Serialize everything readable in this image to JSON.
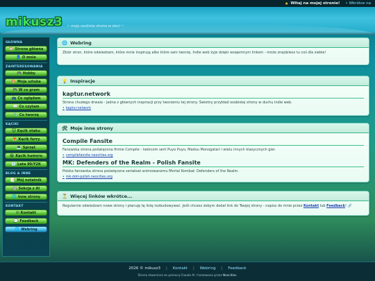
{
  "topbar": {
    "welcome": "Witaj na mojej stronie!",
    "soon": "Wkrótce na"
  },
  "header": {
    "logo": "mikusz3",
    "tagline": "~ moja osobista strona w sieci ~"
  },
  "sidebar": {
    "sections": [
      {
        "title": "GŁÓWNA",
        "items": [
          {
            "icon": "🏠",
            "label": "Strona główna"
          },
          {
            "icon": "👤",
            "label": "O mnie"
          }
        ]
      },
      {
        "title": "ZAINTERESOWANIA",
        "items": [
          {
            "icon": "🎮",
            "label": "Hobby"
          },
          {
            "icon": "🎨",
            "label": "Moja sztuka"
          },
          {
            "icon": "🎮",
            "label": "W co gram"
          },
          {
            "icon": "📺",
            "label": "Co oglądam"
          },
          {
            "icon": "📖",
            "label": "Co czytam"
          },
          {
            "icon": "🔧",
            "label": "Co tworzę"
          }
        ]
      },
      {
        "title": "KĄCIKI",
        "items": [
          {
            "icon": "🐱",
            "label": "Kącik otaku"
          },
          {
            "icon": "🦊",
            "label": "Kącik furry"
          },
          {
            "icon": "💻",
            "label": "Sprzęt"
          },
          {
            "icon": "😂",
            "label": "Kącik humoru"
          },
          {
            "icon": "💿",
            "label": "Lata 90/Y2K"
          }
        ]
      },
      {
        "title": "BLOG & INNE",
        "items": [
          {
            "icon": "📝",
            "label": "Mój notatnik"
          },
          {
            "icon": "🤖",
            "label": "Sekcja z AI"
          },
          {
            "icon": "🌐",
            "label": "Inne strony"
          }
        ]
      },
      {
        "title": "KONTAKT",
        "items": [
          {
            "icon": "✉",
            "label": "Kontakt"
          },
          {
            "icon": "💬",
            "label": "Feedback"
          },
          {
            "icon": "🌐",
            "label": "Webring",
            "active": true
          }
        ]
      }
    ]
  },
  "panels": {
    "webring": {
      "icon": "🌐",
      "title": "Webring",
      "text": "Zbiór stron, które odwiedzam, które mnie inspirują albo które sam tworzę. Indie web żyje dzięki wzajemnym linkom - może znajdziesz tu coś dla siebie!"
    },
    "inspiration": {
      "icon": "💡",
      "title": "Inspiracje",
      "entry_title": "kaptur.network",
      "entry_text": "Strona chudego drwala - jedna z głównych inspiracji przy tworzeniu tej strony. Świetny przykład osobistej strony w duchu indie web.",
      "entry_link": "kaptur.network"
    },
    "others": {
      "icon": "🛠",
      "title": "Moje inne strony",
      "entries": [
        {
          "title": "Compile Fansite",
          "text": "Fanowska strona poświęcona firmie Compile - twórcom serii Puyo Puyo, Madou Monogatari i wielu innych klasycznych gier.",
          "link": "compilefansite.neocities.org"
        },
        {
          "title": "MK: Defenders of the Realm - Polish Fansite",
          "text": "Polska fanowska strona poświęcona serialowi animowanemu Mortal Kombat: Defenders of the Realm.",
          "link": "mk-dotr-polish.neocities.org"
        }
      ]
    },
    "more": {
      "icon": "⏳",
      "title": "Więcej linków wkrótce...",
      "text_before": "Regularnie odwiedzam nowe strony i planuję tę listę rozbudowywać. Jeśli chcesz żebym dodał link do Twojej strony - napisz do mnie przez",
      "link1": "Kontakt",
      "text_mid": "lub",
      "link2": "Feedback",
      "text_after": "! 🔗"
    }
  },
  "footer": {
    "copyright": "2026 © mikusz3",
    "links": [
      "Kontakt",
      "Webring",
      "Feedback"
    ],
    "note_before": "Strona stworzona ze pomocą Claude AI i hostowana przez",
    "note_host": "Neocities."
  },
  "colors": {
    "accent_green": "#3fe05a",
    "button_green": "#6fd14a",
    "active_blue": "#4ec3ea",
    "link_blue": "#1c3fb0",
    "footer_bg": "#0b2d36"
  }
}
